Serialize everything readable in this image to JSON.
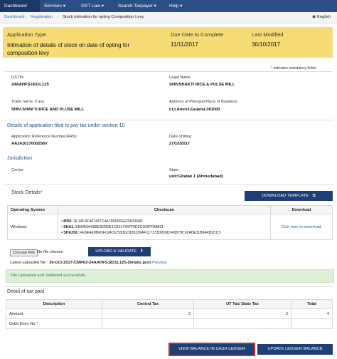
{
  "nav": {
    "items": [
      "Dashboard",
      "Services ▾",
      "GST Law ▾",
      "Search Taxpayer ▾",
      "Help ▾"
    ]
  },
  "breadcrumb": {
    "home": "Dashboard",
    "sep": "›",
    "registration": "Registration",
    "current": "Stock intimation for opting Composition Levy",
    "language": "English"
  },
  "header": {
    "app_type_label": "Application Type",
    "app_type_value": "Intimation of details of stock on date of opting for composition levy",
    "due_label": "Due Date to Complete",
    "due_value": "11/11/2017",
    "modified_label": "Last Modified",
    "modified_value": "30/10/2017"
  },
  "mandatory_note": "indicates mandatory fields",
  "taxpayer": {
    "gstin_label": "GSTIN",
    "gstin_value": "24AAHFS1831L1Z5",
    "legal_name_label": "Legal Name",
    "legal_name_value": "SHIVSHAKTI RICE & PULSE MILL",
    "trade_name_label": "Trade name, if any",
    "trade_name_value": "SHIV-SHAKTI RICE AND PLUSE MILL",
    "address_label": "Address of Principal Place of Business",
    "address_value": "t,t,t,Amreli,Gujarat,381000"
  },
  "filing": {
    "section_title": "Details of application filed to pay tax under section 10",
    "arn_label": "Application Reference Number(ARN)",
    "arn_value": "AA241017000256V",
    "date_label": "Date of filing",
    "date_value": "27/10/2017"
  },
  "jurisdiction": {
    "section_title": "Jurisdiction",
    "centre_label": "Centre",
    "state_label": "State",
    "state_value": "unit:Ghatak 1 (Ahmedabad)"
  },
  "stock": {
    "title": "Stock Details",
    "download_template": "DOWNLOAD TEMPLATE",
    "headers": [
      "Operating System",
      "Checksum",
      "Download"
    ],
    "os": "Windows",
    "checksums": [
      {
        "algo": "MD5:",
        "value": "3E1AF4F407447C4A765D66EED9D060D"
      },
      {
        "algo": "SHA1:",
        "value": "EE8469435BE5D0DE1C6317947F0D3C393FFA8831"
      },
      {
        "algo": "SHA256:",
        "value": "FE8EAE9B6DF024C675916C909239AF117173D839D343878C92ABE11B64FB2CC3"
      }
    ],
    "download_link": "Click here to download.",
    "choose_file": "Choose File",
    "no_file": "No file chosen",
    "upload_btn": "UPLOAD & VALIDATE",
    "latest_label": "Latest uploaded file :",
    "latest_file": "30-Oct-2017-CMP03-24AAHFS1831L1Z5-Details.json",
    "preview": "Preview",
    "success_msg": "File Uploaded and Validated successfully"
  },
  "tax": {
    "title": "Detail of tax paid",
    "headers": [
      "Description",
      "Central Tax",
      "UT Tax/ State Tax",
      "Total"
    ],
    "rows": [
      {
        "desc": "Amount",
        "central": "2",
        "state": "2",
        "total": "4"
      },
      {
        "desc": "Debit Entry No.",
        "central": "",
        "state": "",
        "total": ""
      }
    ]
  },
  "footer": {
    "view_balance": "VIEW BALANCE IN CASH LEDGER",
    "update_ledger": "UPDATE LEDGER BALANCE"
  },
  "colors": {
    "nav": "#2c4e86",
    "header_yellow": "#f7dc76",
    "button": "#1e3f73",
    "success_bg": "#dff0d8",
    "highlight_red": "#d9251d"
  }
}
